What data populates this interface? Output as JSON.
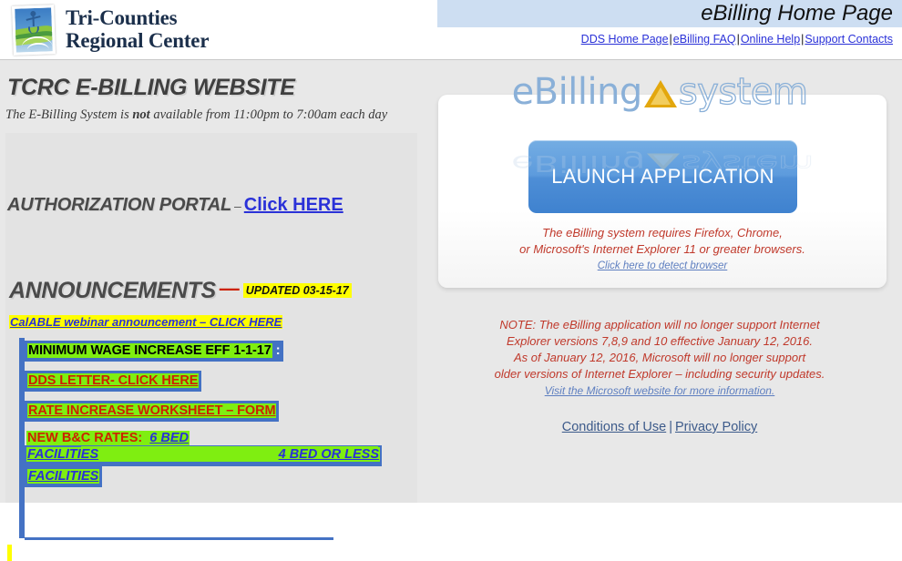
{
  "header": {
    "logo_line1": "Tri-Counties",
    "logo_line2": "Regional Center",
    "logo_icon": "tcrc-landscape-logo",
    "banner_title": "eBilling Home Page",
    "links": [
      {
        "label": "DDS Home Page",
        "name": "dds-home-page-link"
      },
      {
        "label": "eBilling FAQ",
        "name": "ebilling-faq-link"
      },
      {
        "label": "Online Help",
        "name": "online-help-link"
      },
      {
        "label": "Support Contacts",
        "name": "support-contacts-link"
      }
    ],
    "separator": "|"
  },
  "left": {
    "site_title": "TCRC E-BILLING WEBSITE",
    "availability_pre": "The E-Billing System is ",
    "availability_bold": "not",
    "availability_post": " available from 11:00pm to 7:00am each day",
    "auth_portal_label": "AUTHORIZATION PORTAL",
    "auth_portal_dash": "–",
    "auth_portal_link": "Click HERE",
    "announcements_title": "ANNOUNCEMENTS",
    "announcements_dash": "—",
    "announcements_updated": "UPDATED 03-15-17",
    "calable_link": "CalABLE webinar announcement – CLICK HERE",
    "items": [
      {
        "label": "MINIMUM WAGE INCREASE EFF 1-1-17",
        "style": "black",
        "trailing": ":"
      },
      {
        "label": "DDS LETTER- CLICK HERE",
        "style": "red",
        "trailing": ""
      },
      {
        "label": "RATE INCREASE WORKSHEET – FORM",
        "style": "red",
        "trailing": ""
      }
    ],
    "bc_rates": {
      "label": "NEW B&C RATES:",
      "six_bed": "6 BED",
      "facilities_1": "FACILITIES",
      "four_bed_or_less": "4 BED OR LESS",
      "facilities_2": "FACILITIES"
    }
  },
  "right": {
    "logo_word1": "eBilling",
    "logo_icon": "orange-triangle-icon",
    "logo_word2": "system",
    "launch_label": "LAUNCH APPLICATION",
    "browser_note_line1": "The eBilling system requires Firefox, Chrome,",
    "browser_note_line2": "or Microsoft's Internet Explorer 11 or greater browsers.",
    "detect_browser_link": "Click here to detect browser",
    "note_line1": "NOTE: The eBilling application will no longer support Internet",
    "note_line2": "Explorer versions 7,8,9 and 10 effective January 12, 2016.",
    "note_line3": "As of January 12, 2016, Microsoft will no longer support",
    "note_line4": "older versions of Internet Explorer – including security updates.",
    "microsoft_link": "Visit the Microsoft website for more information.",
    "footer": {
      "conditions_label": "Conditions of Use",
      "separator": "|",
      "privacy_label": "Privacy Policy"
    }
  },
  "colors": {
    "banner_blue": "#cddef2",
    "link_blue": "#2a31d8",
    "accent_blue": "#4472c4",
    "highlight_green": "#7fee11",
    "highlight_yellow": "#ffff00",
    "note_red": "#c0392b",
    "button_blue": "#5d9bdd",
    "triangle_orange": "#e3a70d"
  }
}
